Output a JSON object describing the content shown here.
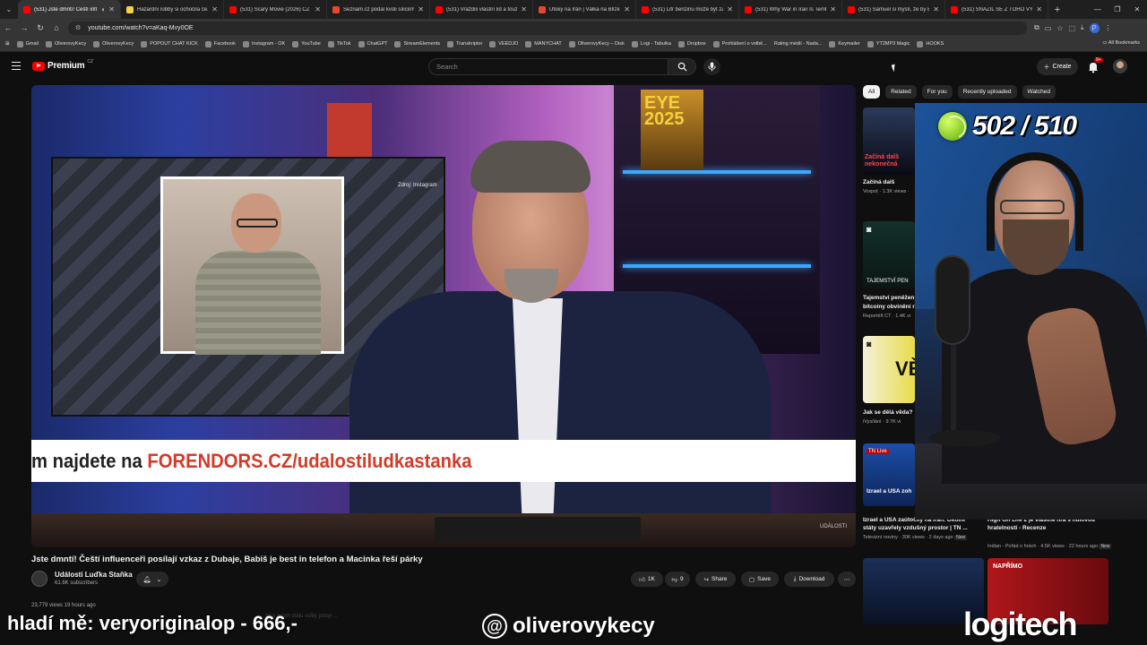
{
  "browser": {
    "tabs": [
      {
        "label": "(531) Jste dmntí! Čeští infl...",
        "active": true,
        "icon": "youtube"
      },
      {
        "label": "Hazardní lobby si ochočila če...",
        "icon": "yellow"
      },
      {
        "label": "(531) Scary Movie (2026) CZ Ti...",
        "icon": "youtube"
      },
      {
        "label": "Seznam.cz podal kvůli síliciím...",
        "icon": "orange"
      },
      {
        "label": "(531) Vraždili vlastní lid a touží...",
        "icon": "youtube"
      },
      {
        "label": "Útoky na Írán | Válka na Blízk...",
        "icon": "orange"
      },
      {
        "label": "(531) Litr benzinu může být za...",
        "icon": "youtube"
      },
      {
        "label": "(531) Why War in Iran Is Terrib...",
        "icon": "youtube"
      },
      {
        "label": "(531) Samuel si myslí, že by Er...",
        "icon": "youtube"
      },
      {
        "label": "(531) SNAŽIL SE Z TOHO VYB...",
        "icon": "youtube"
      }
    ],
    "url": "youtube.com/watch?v=aKaq-Mvy0OE",
    "bookmarks": [
      "Gmail",
      "OliverovyKecy",
      "OliverovyKecy",
      "POPOUT CHAT KICK",
      "Facebook",
      "Instagram - OK",
      "YouTube",
      "TikTok",
      "ChatGPT",
      "StreamElements",
      "Transkriptor",
      "VEEDJO",
      "MANYCHAT",
      "OliverovyKecy – Disk",
      "Logi - Tabulka",
      "Dropbox",
      "Prohlášení o volbě...",
      "Rating médií - Nada...",
      "Keymailer",
      "YT2MP3 Magic",
      "HOOKS"
    ],
    "all_bookmarks": "All Bookmarks"
  },
  "yt": {
    "logo_text": "Premium",
    "region": "CZ",
    "search_placeholder": "Search",
    "create_label": "Create",
    "notif_count": "9+"
  },
  "video": {
    "banner_prefix": "m najdete na ",
    "banner_url": "FORENDORS.CZ/udalostiludkastanka",
    "tv_label": "Zdroj: Instagram",
    "watermark": "UDÁLOSTI",
    "title": "Jste dmntí! Čeští influenceři posílají vzkaz z Dubaje, Babiš je best in telefon a Macinka řeší párky",
    "channel": "Události Luďka Staňka",
    "subscribers": "61.6K subscribers",
    "likes": "1K",
    "dislikes": "9",
    "share_label": "Share",
    "save_label": "Save",
    "download_label": "Download",
    "views_line": "23,779 views  19 hours ago",
    "desc_faded": "... fóra mnoh státu volby pobyl ..."
  },
  "sidebar": {
    "chips": [
      "All",
      "Related",
      "For you",
      "Recently uploaded",
      "Watched"
    ],
    "recs": [
      {
        "title": "Začíná dalš",
        "meta": "Voxpot · 1.3K views ·",
        "thumb_text": "Začíná dalš nekonečná"
      },
      {
        "title": "Tajemství peněžen",
        "title2": "bitcoiny obvinění r",
        "meta": "Reportéři ČT · 1.4K vi",
        "thumb_text": "TAJEMSTVÍ PEN"
      },
      {
        "title": "Jak se dělá věda?",
        "meta": "iVysílání · 9.7K vi",
        "thumb_text": "VĚ"
      },
      {
        "title": "Izrael a USA útočí",
        "meta": "",
        "thumb_text": "Izrael a USA zoh"
      }
    ],
    "rec_wide_left": {
      "title": "Izrael a USA zaútočily na Írán. Okolní státy uzavřely vzdušný prostor | TN ...",
      "meta": "Televizní noviny · 30K views · 2 days ago",
      "badge": "New"
    },
    "rec_wide_right": {
      "title": "High On Life 2 je vlastně hra s nulovou hratelností - Recenze",
      "meta": "Indian - Pořád o hrách · 4.5K views · 22 hours ago",
      "badge": "New"
    },
    "bottom_right_label": "NAPŘÍMO"
  },
  "stream": {
    "tennis_counter": "502 / 510",
    "donate_text": "hladí mě: veryoriginalop - 666,-",
    "threads_handle": "oliverovykecy",
    "sponsor": "logitech"
  }
}
